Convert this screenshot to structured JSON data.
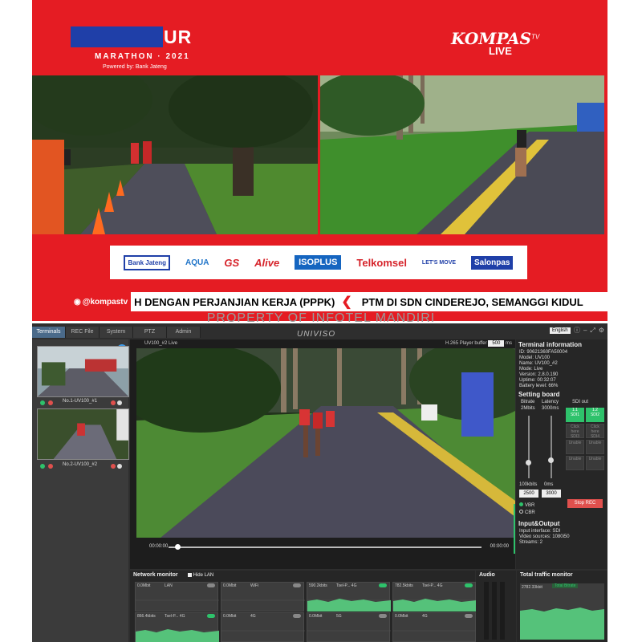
{
  "broadcast": {
    "event_title_tail": "UR",
    "event_subtitle": "MARATHON · 2021",
    "powered_by": "Powered by: Bank Jateng",
    "channel_name": "KOMPAS",
    "channel_suffix": "TV",
    "live_label": "LIVE",
    "sponsors": [
      "Bank Jateng",
      "AQUA",
      "GS",
      "Alive",
      "ISOPLUS",
      "Telkomsel",
      "LET'S MOVE",
      "Salonpas"
    ],
    "ticker_handle": "@kompastv",
    "ticker_segments": [
      "H DENGAN PERJANJIAN KERJA (PPPK)",
      "PTM DI SDN CINDEREJO, SEMANGGI KIDUL"
    ]
  },
  "watermark": "PROPERTY OF INFOTEL MANDIRI",
  "app": {
    "tabs": [
      "Terminals",
      "REC File",
      "System",
      "PTZ",
      "Admin"
    ],
    "active_tab": "Terminals",
    "logo": "UNIVISO",
    "language": "English",
    "terminals": [
      {
        "label": "No.1-UV100_#1"
      },
      {
        "label": "No.2-UV100_#2"
      }
    ],
    "player": {
      "name": "UV100_#2 Live",
      "codec": "H.265",
      "buffer_label": "Player buffer",
      "buffer_value": "500",
      "buffer_unit": "ms",
      "time_start": "00:00:00",
      "time_end": "00:00:00",
      "progress": 0.02
    },
    "terminal_info": {
      "title": "Terminal information",
      "lines": [
        "ID: 90621360FA50004",
        "Model: UV100",
        "Name: UV100_#2",
        "Mode: Live",
        "Version: 2.8.0.190",
        "Uptime: 00:32:07",
        "Battery level: 66%"
      ]
    },
    "setting_board": {
      "title": "Setting board",
      "bitrate_label": "Bitrate",
      "bitrate_current": "2Mbits",
      "latency_label": "Latency",
      "latency_current": "3000ms",
      "sdi_out_label": "SDI out",
      "bitrate_min": "100kbits",
      "latency_min": "0ms",
      "bitrate_value": "2500",
      "latency_value": "3000",
      "sdi_cells": [
        {
          "top": "1.1",
          "bottom": "SDI1",
          "state": "on"
        },
        {
          "top": "1.2",
          "bottom": "SDI2",
          "state": "on"
        },
        {
          "top": "Click here",
          "bottom": "SDI3",
          "state": "off"
        },
        {
          "top": "Click here",
          "bottom": "SDI4",
          "state": "off"
        },
        {
          "top": "Unable",
          "bottom": "",
          "state": "off"
        },
        {
          "top": "Unable",
          "bottom": "",
          "state": "off"
        },
        {
          "top": "Unable",
          "bottom": "",
          "state": "off"
        },
        {
          "top": "Unable",
          "bottom": "",
          "state": "off"
        }
      ],
      "mode_options": [
        "VBR",
        "CBR"
      ],
      "mode_selected": "VBR",
      "rec_button": "Stop REC"
    },
    "io": {
      "title": "Input&Output",
      "lines": [
        "Input interface: SDI",
        "Video sources: 1080i50",
        "Streams: 2"
      ]
    },
    "network_monitor": {
      "title": "Network monitor",
      "hide_lan": "Hide LAN",
      "panels": [
        {
          "rate": "0.0Mbit",
          "name": "LAN",
          "active": false
        },
        {
          "rate": "0.0Mbit",
          "name": "WiFi",
          "active": false
        },
        {
          "rate": "590.2kbits",
          "name": "Tsel-P... 4G",
          "active": true
        },
        {
          "rate": "782.5kbits",
          "name": "Tsel-P... 4G",
          "active": true
        },
        {
          "rate": "866.4kbits",
          "name": "Tsel-P... 4G",
          "active": true
        },
        {
          "rate": "0.0Mbit",
          "name": "4G",
          "active": false
        },
        {
          "rate": "0.0Mbit",
          "name": "5G",
          "active": false
        },
        {
          "rate": "0.0Mbit",
          "name": "4G",
          "active": false
        }
      ]
    },
    "audio_title": "Audio",
    "traffic": {
      "title": "Total traffic monitor",
      "rate": "2782.33kbit",
      "badge": "Total Bitrate"
    }
  },
  "colors": {
    "broadcast_red": "#e51c23",
    "accent_green": "#2ec26b",
    "accent_blue": "#3d9be9",
    "rec_red": "#e0504d",
    "app_bg": "#2e2e2e"
  }
}
